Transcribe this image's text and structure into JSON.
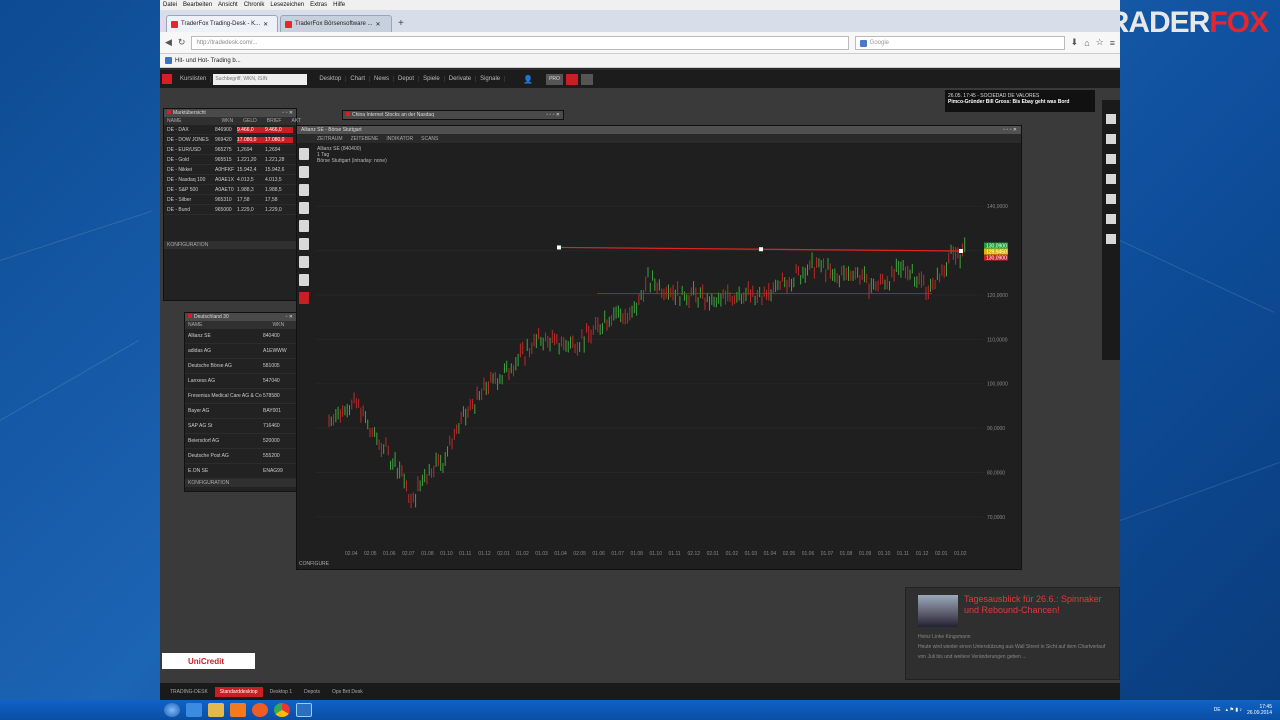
{
  "desktop": {
    "brand_prefix": "TRADER",
    "brand_suffix": "FOX"
  },
  "browser": {
    "menu": [
      "Datei",
      "Bearbeiten",
      "Ansicht",
      "Chronik",
      "Lesezeichen",
      "Extras",
      "Hilfe"
    ],
    "tabs": [
      {
        "label": "TraderFox Trading-Desk - K..."
      },
      {
        "label": "TraderFox Börsensoftware ..."
      }
    ],
    "url": "http://tradedesk.com/...",
    "search_placeholder": "Google",
    "bookmark": "Hit- und Hot- Trading b..."
  },
  "app": {
    "nav": [
      "Kurslisten",
      "Desktop",
      "Chart",
      "News",
      "Depot",
      "Spiele",
      "Derivate",
      "Signale"
    ],
    "search_placeholder": "Suchbegriff, WKN, ISIN",
    "pro": "PRO",
    "notice_time": "26.05. 17:45 - SOCIEDAD DE VALORES",
    "notice_text": "Pimco-Gründer Bill Gross: Bis Ebay geht was Bord",
    "market_panel": {
      "title": "Marktübersicht",
      "columns": [
        "NAME",
        "WKN",
        "GELD",
        "BRIEF",
        "AKT"
      ],
      "rows": [
        {
          "name": "DE - DAX",
          "wkn": "846900",
          "v1": "9.466,0",
          "v2": "9.466,0"
        },
        {
          "name": "DE - DOW JONES",
          "wkn": "969420",
          "v1": "17.080,0",
          "v2": "17.080,0"
        },
        {
          "name": "DE - EUR/USD",
          "wkn": "965275",
          "v1": "1,2694",
          "v2": "1,2694"
        },
        {
          "name": "DE - Gold",
          "wkn": "965515",
          "v1": "1.221,20",
          "v2": "1.221,28"
        },
        {
          "name": "DE - Nikkei",
          "wkn": "A0HFKF",
          "v1": "15.942,4",
          "v2": "15.942,6"
        },
        {
          "name": "DE - Nasdaq 100",
          "wkn": "A0AE1X",
          "v1": "4.013,5",
          "v2": "4.013,5"
        },
        {
          "name": "DE - S&P 500",
          "wkn": "A0AET0",
          "v1": "1.988,3",
          "v2": "1.988,5"
        },
        {
          "name": "DE - Silber",
          "wkn": "965310",
          "v1": "17,58",
          "v2": "17,58"
        },
        {
          "name": "DE - Bund",
          "wkn": "965000",
          "v1": "1.229,0",
          "v2": "1.229,0"
        }
      ],
      "footer": "KONFIGURATION"
    },
    "de_panel": {
      "title": "Deutschland 30",
      "columns": [
        "NAME",
        "WKN"
      ],
      "rows": [
        {
          "name": "Allianz SE",
          "wkn": "840400"
        },
        {
          "name": "adidas AG",
          "wkn": "A1EWWW"
        },
        {
          "name": "Deutsche Börse AG",
          "wkn": "581005"
        },
        {
          "name": "Lanxess AG",
          "wkn": "547040"
        },
        {
          "name": "Fresenius Medical Care AG & Co",
          "wkn": "578580"
        },
        {
          "name": "Bayer AG",
          "wkn": "BAY001"
        },
        {
          "name": "SAP AG St",
          "wkn": "716460"
        },
        {
          "name": "Beiersdorf AG",
          "wkn": "520000"
        },
        {
          "name": "Deutsche Post AG",
          "wkn": "555200"
        },
        {
          "name": "E.ON SE",
          "wkn": "ENAG99"
        }
      ],
      "footer": "KONFIGURATION"
    },
    "side_panel_title": "China Internet Stocks an der Nasdaq",
    "chart": {
      "title": "Allianz SE - Börse Stuttgart",
      "toolbar": [
        "ZEITRAUM",
        "ZEITEBENE",
        "INDIKATOR",
        "SCANS"
      ],
      "instrument": "Allianz SE (840400)",
      "interval": "1 Tag",
      "subtitle": "Börse Stuttgart (intraday: none)",
      "price_labels": [
        "140,0000",
        "130,0000",
        "120,0000",
        "110,0000",
        "100,0000",
        "90,0000",
        "80,0000",
        "70,0000"
      ],
      "last_prices": [
        "130,0900",
        "129,9450",
        "130,0900"
      ],
      "x_labels": [
        "02.04",
        "02.05",
        "01.06",
        "02.07",
        "01.08",
        "01.10",
        "01.11",
        "01.12",
        "02.01",
        "01.02",
        "01.03",
        "01.04",
        "02.05",
        "01.06",
        "01.07",
        "01.08",
        "01.10",
        "01.11",
        "02.12",
        "02.01",
        "01.02",
        "01.03",
        "01.04",
        "02.05",
        "01.06",
        "01.07",
        "01.08",
        "01.09",
        "01.10",
        "01.11",
        "01.12",
        "02.01",
        "01.02"
      ],
      "footer": "CONFIGURE"
    },
    "news": {
      "title": "Tagesausblick für 26.6.: Spinnaker und Rebound-Chancen!",
      "meta": "Heinz Linke Kingsmann",
      "text": "Heute wird wieder einen Unterstützung aus Wall Street in Sicht auf dem Chartverlauf von Juli bis und weitere Veränderungen geben ..."
    },
    "unicredit": "UniCredit",
    "app_tabs": [
      "TRADING-DESK",
      "Standarddesktop",
      "Desktop 1",
      "Depots",
      "Ops Brit Desk"
    ],
    "app_tab_active": 1
  },
  "taskbar": {
    "lang": "DE",
    "time": "17:45",
    "date": "26.09.2014"
  }
}
